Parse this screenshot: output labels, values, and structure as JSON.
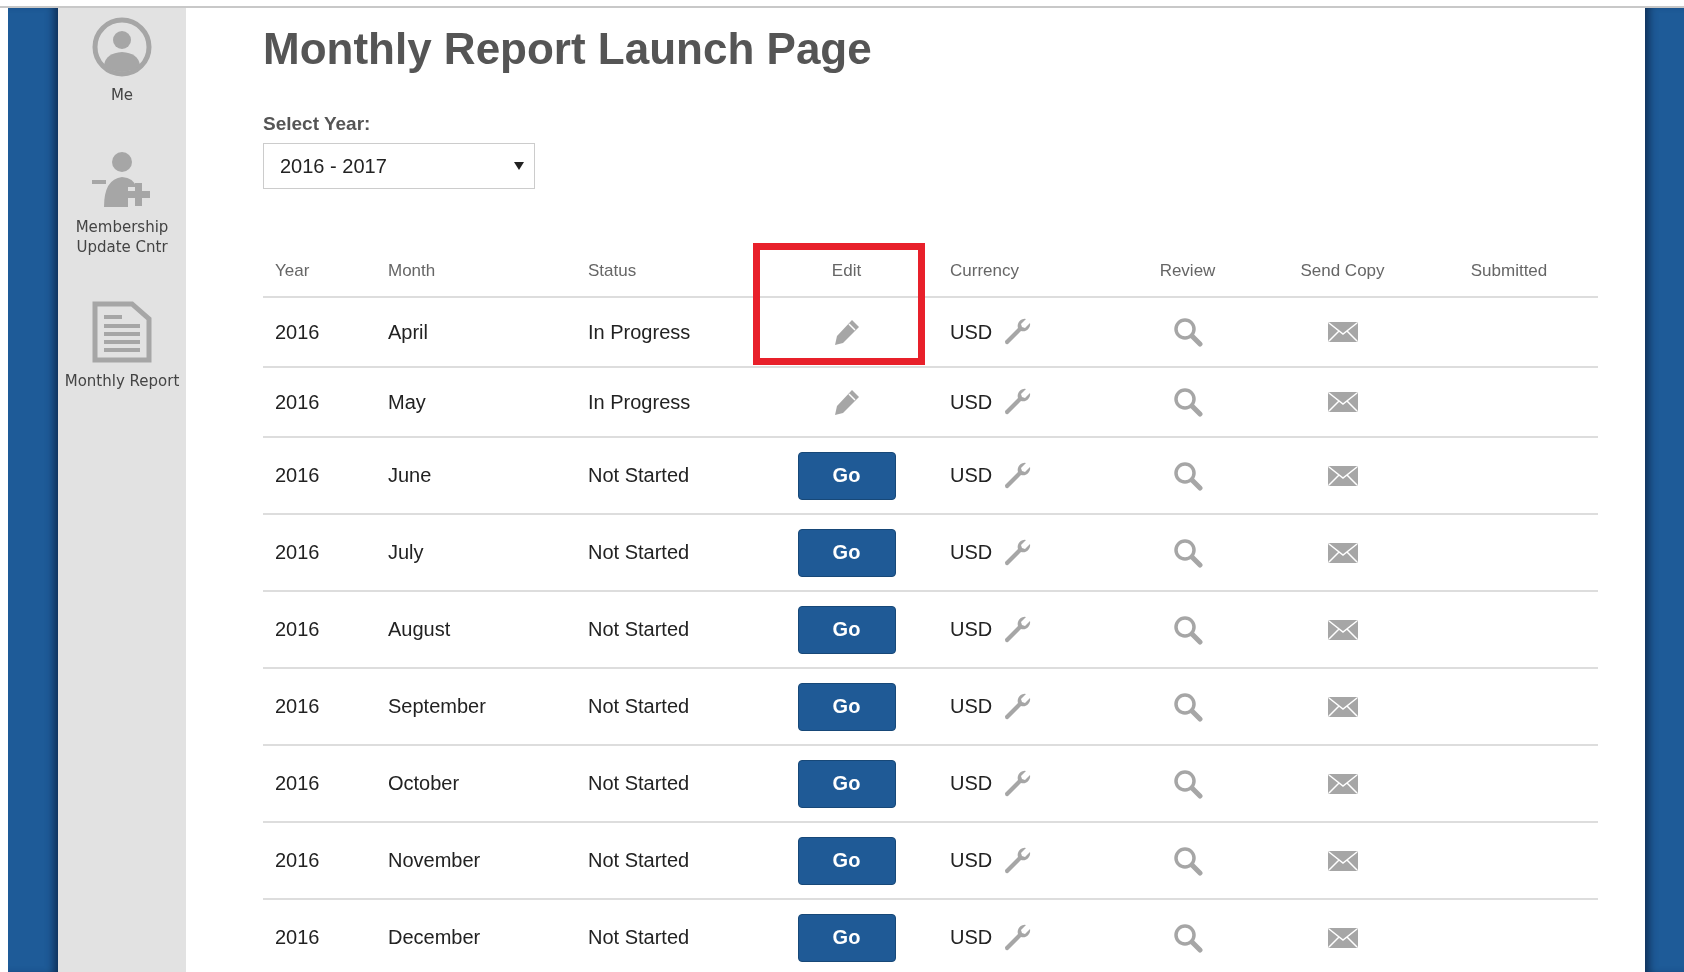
{
  "sidebar": {
    "items": [
      {
        "kind": "person",
        "label": "Me"
      },
      {
        "kind": "person-add",
        "label": "Membership Update Cntr"
      },
      {
        "kind": "document",
        "label": "Monthly Report"
      }
    ]
  },
  "title": "Monthly Report Launch Page",
  "year_select": {
    "label": "Select Year:",
    "value": "2016 - 2017"
  },
  "table": {
    "annotation": {
      "kind": "frame"
    },
    "columns": [
      {
        "label": "Year"
      },
      {
        "label": "Month"
      },
      {
        "label": "Status"
      },
      {
        "label": "Edit"
      },
      {
        "label": "Currency"
      },
      {
        "label": "Review"
      },
      {
        "label": "Send Copy"
      },
      {
        "label": "Submitted"
      }
    ],
    "rows": [
      {
        "year": "2016",
        "month": "April",
        "status": "In Progress",
        "edit": {
          "kind": "pencil"
        },
        "currency": "USD"
      },
      {
        "year": "2016",
        "month": "May",
        "status": "In Progress",
        "edit": {
          "kind": "pencil"
        },
        "currency": "USD"
      },
      {
        "year": "2016",
        "month": "June",
        "status": "Not Started",
        "edit": {
          "kind": "button",
          "label": "Go"
        },
        "currency": "USD"
      },
      {
        "year": "2016",
        "month": "July",
        "status": "Not Started",
        "edit": {
          "kind": "button",
          "label": "Go"
        },
        "currency": "USD"
      },
      {
        "year": "2016",
        "month": "August",
        "status": "Not Started",
        "edit": {
          "kind": "button",
          "label": "Go"
        },
        "currency": "USD"
      },
      {
        "year": "2016",
        "month": "September",
        "status": "Not Started",
        "edit": {
          "kind": "button",
          "label": "Go"
        },
        "currency": "USD"
      },
      {
        "year": "2016",
        "month": "October",
        "status": "Not Started",
        "edit": {
          "kind": "button",
          "label": "Go"
        },
        "currency": "USD"
      },
      {
        "year": "2016",
        "month": "November",
        "status": "Not Started",
        "edit": {
          "kind": "button",
          "label": "Go"
        },
        "currency": "USD"
      },
      {
        "year": "2016",
        "month": "December",
        "status": "Not Started",
        "edit": {
          "kind": "button",
          "label": "Go"
        },
        "currency": "USD"
      }
    ]
  }
}
